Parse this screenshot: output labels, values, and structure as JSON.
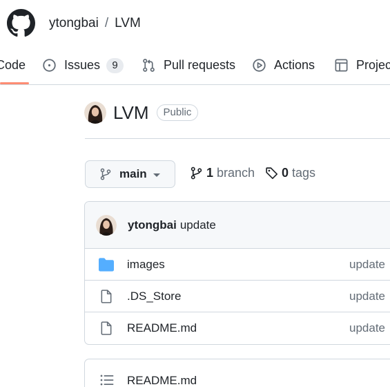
{
  "header": {
    "owner": "ytongbai",
    "separator": "/",
    "repo": "LVM"
  },
  "tabs": {
    "code": "Code",
    "issues": "Issues",
    "issues_count": "9",
    "pulls": "Pull requests",
    "actions": "Actions",
    "projects": "Projec"
  },
  "repo": {
    "name": "LVM",
    "visibility": "Public"
  },
  "branch": {
    "current": "main",
    "branch_count": "1",
    "branch_label": "branch",
    "tag_count": "0",
    "tag_label": "tags"
  },
  "commit": {
    "author": "ytongbai",
    "message": "update"
  },
  "files": [
    {
      "name": "images",
      "type": "folder",
      "commit": "update"
    },
    {
      "name": ".DS_Store",
      "type": "file",
      "commit": "update"
    },
    {
      "name": "README.md",
      "type": "file",
      "commit": "update"
    }
  ],
  "readme": {
    "title": "README.md"
  },
  "colors": {
    "accent_underline": "#fd8c73",
    "folder": "#54aeff",
    "border": "#d0d7de",
    "muted": "#636c76"
  }
}
